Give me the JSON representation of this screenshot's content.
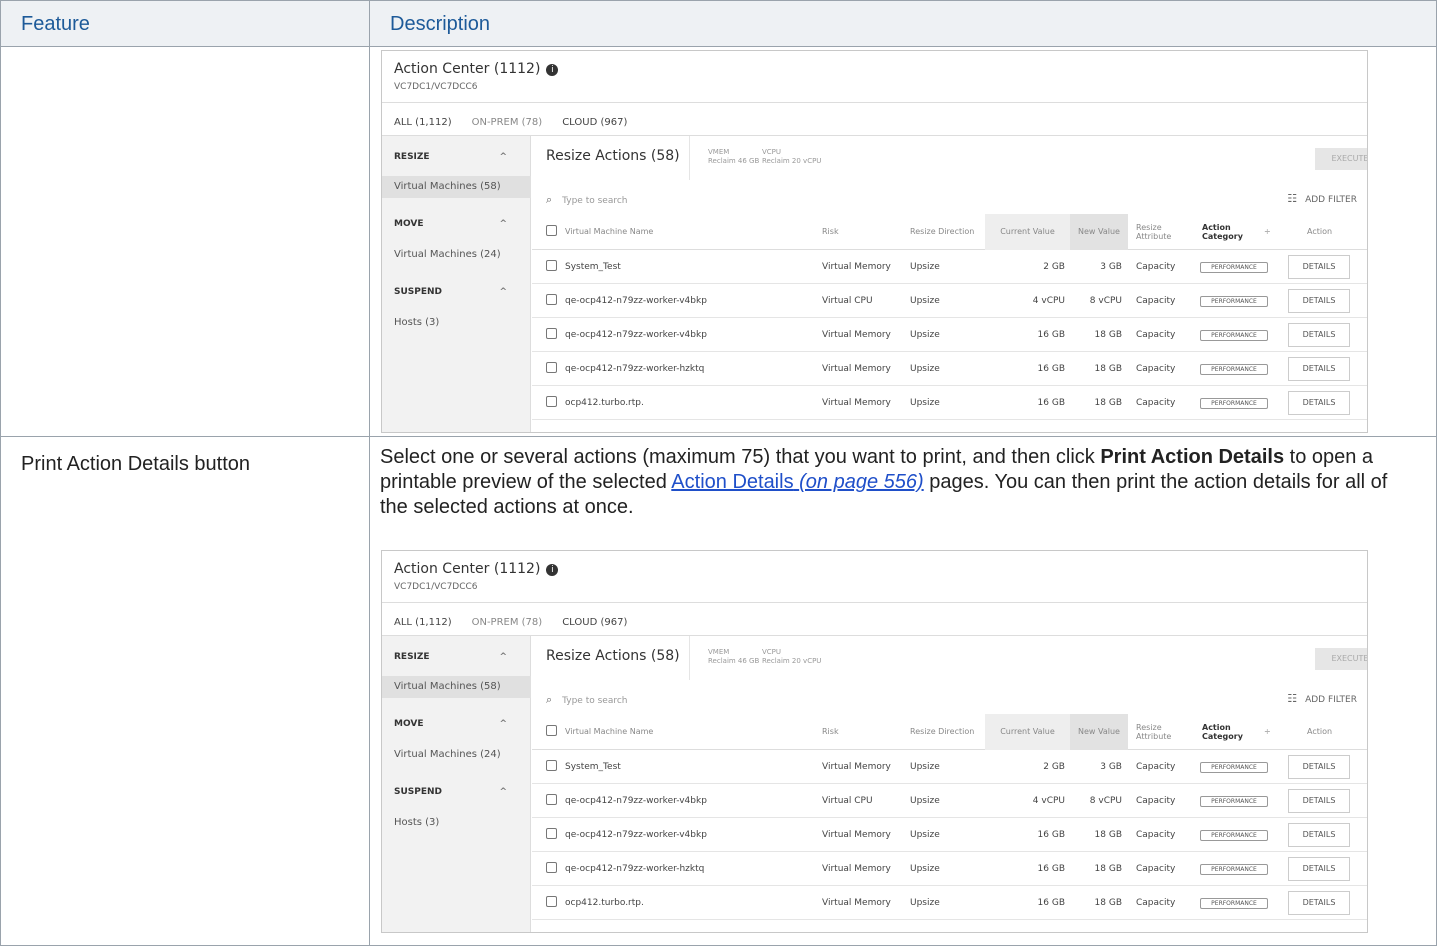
{
  "table": {
    "header_feature": "Feature",
    "header_description": "Description"
  },
  "row2": {
    "feature": "Print Action Details button",
    "desc_part1": "Select one or several actions (maximum 75) that you want to print, and then click ",
    "desc_bold": "Print Action Details",
    "desc_part2": " to open a printable preview of the selected ",
    "desc_link": "Action Details",
    "desc_link_page": "(on page 556)",
    "desc_part3": " pages. You can then print the action details for all of the selected actions at once."
  },
  "shot": {
    "title": "Action Center (1112)",
    "info_icon": "i",
    "subtitle": "VC7DC1/VC7DCC6",
    "tabs": [
      "ALL (1,112)",
      "ON-PREM (78)",
      "CLOUD (967)"
    ],
    "sidebar": {
      "resize_head": "RESIZE",
      "resize_item": "Virtual Machines (58)",
      "move_head": "MOVE",
      "move_item": "Virtual Machines (24)",
      "suspend_head": "SUSPEND",
      "suspend_item": "Hosts (3)",
      "caret": "^"
    },
    "resize_actions_title": "Resize Actions (58)",
    "stat_vmem_label": "VMEM",
    "stat_vmem_value": "Reclaim 46 GB",
    "stat_vcpu_label": "VCPU",
    "stat_vcpu_value": "Reclaim 20 vCPU",
    "execute_button": "EXECUTE ACTIONS",
    "gear_icon": "⚙",
    "download_icon": "⤓",
    "print_icon": "⎙",
    "search_icon": "⌕",
    "search_placeholder": "Type to search",
    "filter_icon": "☷",
    "add_filter": "ADD FILTER",
    "columns": {
      "name": "Virtual Machine Name",
      "risk": "Risk",
      "direction": "Resize Direction",
      "current": "Current Value",
      "new": "New Value",
      "attr1": "Resize",
      "attr2": "Attribute",
      "cat1": "Action",
      "cat2": "Category",
      "cat_sort": "÷",
      "action": "Action"
    },
    "rows": [
      {
        "name": "System_Test",
        "risk": "Virtual Memory",
        "direction": "Upsize",
        "current": "2 GB",
        "new": "3 GB",
        "attribute": "Capacity",
        "category": "PERFORMANCE",
        "action": "DETAILS"
      },
      {
        "name": "qe-ocp412-n79zz-worker-v4bkp",
        "risk": "Virtual CPU",
        "direction": "Upsize",
        "current": "4 vCPU",
        "new": "8 vCPU",
        "attribute": "Capacity",
        "category": "PERFORMANCE",
        "action": "DETAILS"
      },
      {
        "name": "qe-ocp412-n79zz-worker-v4bkp",
        "risk": "Virtual Memory",
        "direction": "Upsize",
        "current": "16 GB",
        "new": "18 GB",
        "attribute": "Capacity",
        "category": "PERFORMANCE",
        "action": "DETAILS"
      },
      {
        "name": "qe-ocp412-n79zz-worker-hzktq",
        "risk": "Virtual Memory",
        "direction": "Upsize",
        "current": "16 GB",
        "new": "18 GB",
        "attribute": "Capacity",
        "category": "PERFORMANCE",
        "action": "DETAILS"
      },
      {
        "name": "ocp412.turbo.rtp.",
        "risk": "Virtual Memory",
        "direction": "Upsize",
        "current": "16 GB",
        "new": "18 GB",
        "attribute": "Capacity",
        "category": "PERFORMANCE",
        "action": "DETAILS"
      }
    ]
  }
}
